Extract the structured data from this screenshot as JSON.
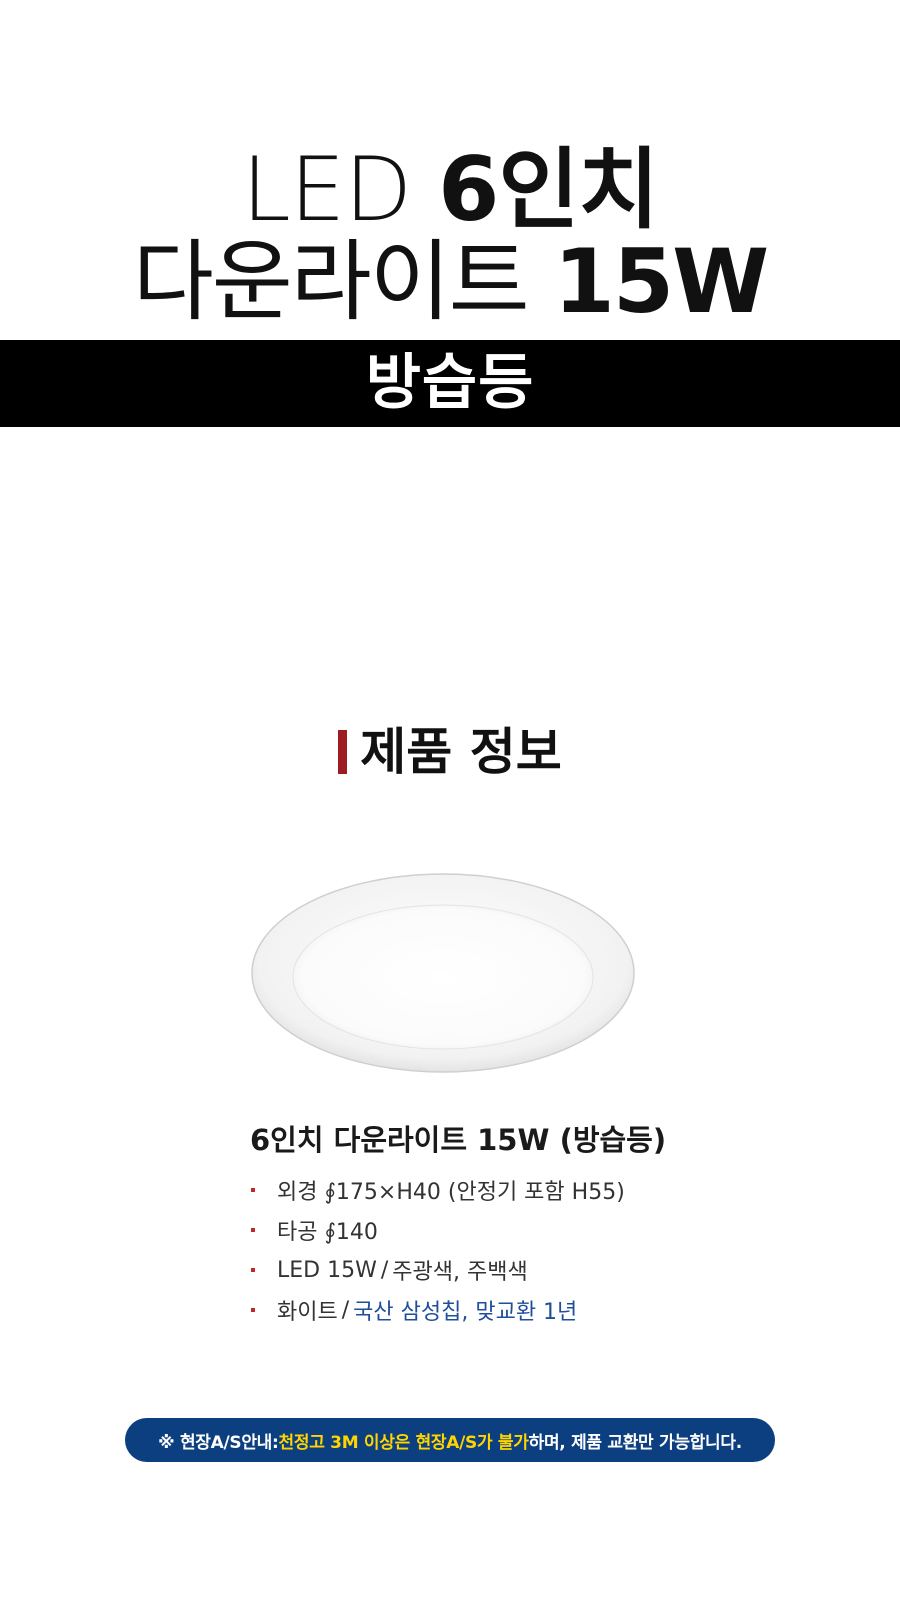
{
  "title": {
    "line1_light": "LED",
    "line1_bold": "6인치",
    "line2_light": "다운라이트",
    "line2_bold": "15W"
  },
  "banner": {
    "label": "방습등"
  },
  "section": {
    "heading": "제품 정보",
    "accent_color": "#9c1c22"
  },
  "product": {
    "name": "6인치 다운라이트 15W (방습등)",
    "specs": {
      "outer_diameter": "외경 ∮175×H40 (안정기 포함 H55)",
      "cutout": "타공 ∮140",
      "led_text": "LED 15W",
      "led_sep": "/",
      "led_colors": "주광색, 주백색",
      "finish_text": "화이트",
      "finish_sep": "/",
      "finish_note": "국산 삼성칩,  맞교환 1년"
    }
  },
  "notice": {
    "lead": "※ 현장A/S안내: ",
    "highlight": "천정고 3M 이상은 현장A/S가 불가",
    "rest": "하며, 제품 교환만 가능합니다.",
    "background": "#0c3f7f",
    "highlight_color": "#ffd400"
  },
  "icons": {
    "product": "round-downlight-image",
    "bullet": "square-bullet-icon"
  }
}
